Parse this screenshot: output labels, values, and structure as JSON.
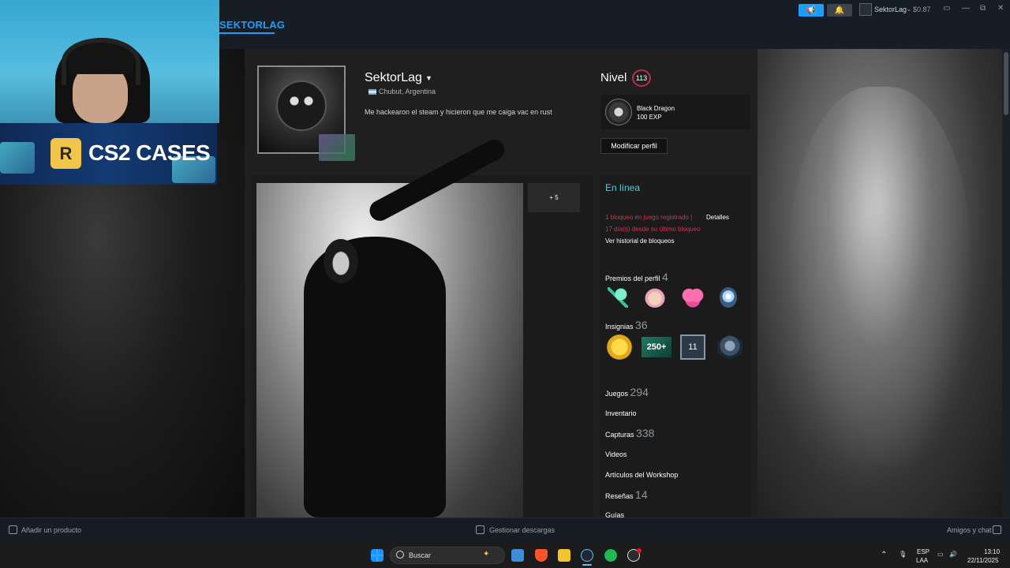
{
  "nav": {
    "active_tab": "SEKTORLAG"
  },
  "account": {
    "username": "SektorLag",
    "wallet": "$0.87"
  },
  "profile": {
    "name": "SektorLag",
    "location": "Chubut, Argentina",
    "summary": "Me hackearon el steam y hicieron que me caiga vac en rust",
    "level_label": "Nivel",
    "level": "113",
    "featured_badge": {
      "name": "Black Dragon",
      "xp": "100 EXP"
    },
    "edit_button": "Modificar perfil",
    "showcase_more": "+ 5"
  },
  "sidebar": {
    "status": "En línea",
    "ban_line1": "1 bloqueo en juego registrado |",
    "ban_details": "Detalles",
    "ban_line2": "17 día(s) desde su último bloqueo",
    "ban_history": "Ver historial de bloqueos",
    "awards_label": "Premios del perfil",
    "awards_count": "4",
    "badges_label": "Insignias",
    "badges_count": "36",
    "badge_250_text": "250+",
    "badge_years_text": "11",
    "games_label": "Juegos",
    "games_count": "294",
    "inventory_label": "Inventario",
    "screenshots_label": "Capturas",
    "screenshots_count": "338",
    "videos_label": "Videos",
    "workshop_label": "Artículos del Workshop",
    "reviews_label": "Reseñas",
    "reviews_count": "14",
    "guides_label": "Guías"
  },
  "bottom_bar": {
    "add_product": "Añadir un producto",
    "downloads": "Gestionar descargas",
    "friends": "Amigos y chat"
  },
  "taskbar": {
    "search_placeholder": "Buscar",
    "lang1": "ESP",
    "lang2": "LAA",
    "time": "13:10",
    "date": "22/11/2025"
  },
  "overlay": {
    "banner_logo": "R",
    "banner_text": "CS2 CASES"
  },
  "colors": {
    "accent": "#1a9fff",
    "status_online": "#57cbde",
    "vac_red": "#c43a53",
    "level_ring": "#b8304a"
  },
  "icons": [
    "megaphone-icon",
    "bell-icon",
    "monitor-icon",
    "minimize-icon",
    "maximize-icon",
    "close-icon",
    "plus-icon",
    "download-icon",
    "chat-icon",
    "windows-start-icon",
    "search-icon",
    "wifi-icon",
    "volume-icon"
  ]
}
